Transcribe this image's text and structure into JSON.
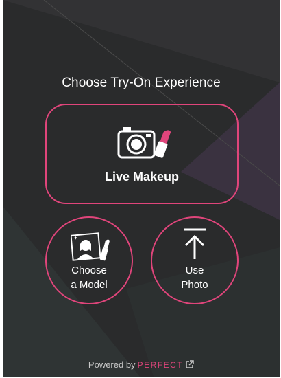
{
  "title": "Choose Try-On Experience",
  "live": {
    "label": "Live Makeup",
    "icon": "camera-lipstick-icon"
  },
  "model": {
    "label_line1": "Choose",
    "label_line2": "a Model",
    "icon": "model-portrait-icon"
  },
  "photo": {
    "label_line1": "Use",
    "label_line2": "Photo",
    "icon": "upload-arrow-icon"
  },
  "footer": {
    "powered_by": "Powered by",
    "brand": "PERFECT",
    "link_icon": "external-link-icon"
  },
  "colors": {
    "accent": "#e0457b",
    "background": "#2a2b2c",
    "text": "#ffffff"
  }
}
